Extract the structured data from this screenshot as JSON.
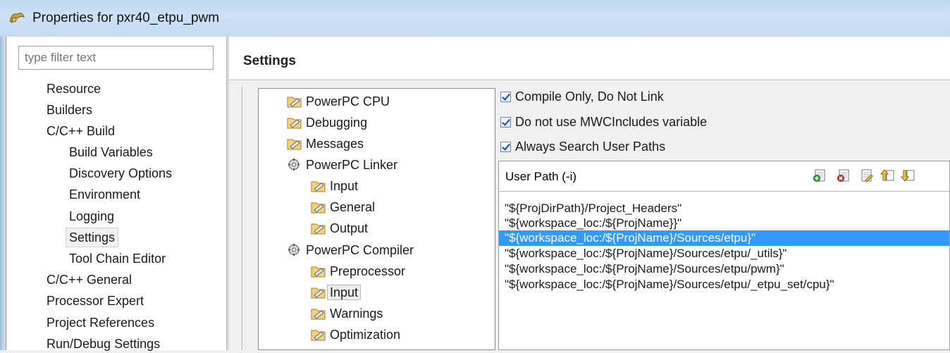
{
  "window": {
    "title": "Properties for pxr40_etpu_pwm"
  },
  "filter": {
    "placeholder": "type filter text"
  },
  "nav": {
    "items": [
      {
        "label": "Resource",
        "level": 0
      },
      {
        "label": "Builders",
        "level": 0
      },
      {
        "label": "C/C++ Build",
        "level": 0
      },
      {
        "label": "Build Variables",
        "level": 1
      },
      {
        "label": "Discovery Options",
        "level": 1
      },
      {
        "label": "Environment",
        "level": 1
      },
      {
        "label": "Logging",
        "level": 1
      },
      {
        "label": "Settings",
        "level": 1,
        "selected": true
      },
      {
        "label": "Tool Chain Editor",
        "level": 1
      },
      {
        "label": "C/C++ General",
        "level": 0
      },
      {
        "label": "Processor Expert",
        "level": 0
      },
      {
        "label": "Project References",
        "level": 0
      },
      {
        "label": "Run/Debug Settings",
        "level": 0
      }
    ]
  },
  "page": {
    "title": "Settings"
  },
  "tool_tree": {
    "items": [
      {
        "label": "PowerPC CPU",
        "icon": "tool-folder-icon",
        "level": 0
      },
      {
        "label": "Debugging",
        "icon": "tool-folder-icon",
        "level": 0
      },
      {
        "label": "Messages",
        "icon": "tool-folder-icon",
        "level": 0
      },
      {
        "label": "PowerPC Linker",
        "icon": "tool-gear-icon",
        "level": 0
      },
      {
        "label": "Input",
        "icon": "tool-folder-icon",
        "level": 1
      },
      {
        "label": "General",
        "icon": "tool-folder-icon",
        "level": 1
      },
      {
        "label": "Output",
        "icon": "tool-folder-icon",
        "level": 1
      },
      {
        "label": "PowerPC Compiler",
        "icon": "tool-gear-icon",
        "level": 0
      },
      {
        "label": "Preprocessor",
        "icon": "tool-folder-icon",
        "level": 1
      },
      {
        "label": "Input",
        "icon": "tool-folder-icon",
        "level": 1,
        "selected": true
      },
      {
        "label": "Warnings",
        "icon": "tool-folder-icon",
        "level": 1
      },
      {
        "label": "Optimization",
        "icon": "tool-folder-icon",
        "level": 1
      }
    ]
  },
  "options": {
    "checkboxes": [
      {
        "label": "Compile Only, Do Not Link",
        "checked": true
      },
      {
        "label": "Do not use MWCIncludes variable",
        "checked": true
      },
      {
        "label": "Always Search User Paths",
        "checked": true
      }
    ]
  },
  "user_path": {
    "label": "User Path (-i)",
    "tools": [
      "add-path-icon",
      "delete-path-icon",
      "edit-path-icon",
      "move-up-icon",
      "move-down-icon"
    ],
    "paths": [
      {
        "value": "\"${ProjDirPath}/Project_Headers\""
      },
      {
        "value": "\"${workspace_loc:/${ProjName}}\""
      },
      {
        "value": "\"${workspace_loc:/${ProjName}/Sources/etpu}\"",
        "selected": true
      },
      {
        "value": "\"${workspace_loc:/${ProjName}/Sources/etpu/_utils}\""
      },
      {
        "value": "\"${workspace_loc:/${ProjName}/Sources/etpu/pwm}\""
      },
      {
        "value": "\"${workspace_loc:/${ProjName}/Sources/etpu/_etpu_set/cpu}\""
      }
    ]
  }
}
